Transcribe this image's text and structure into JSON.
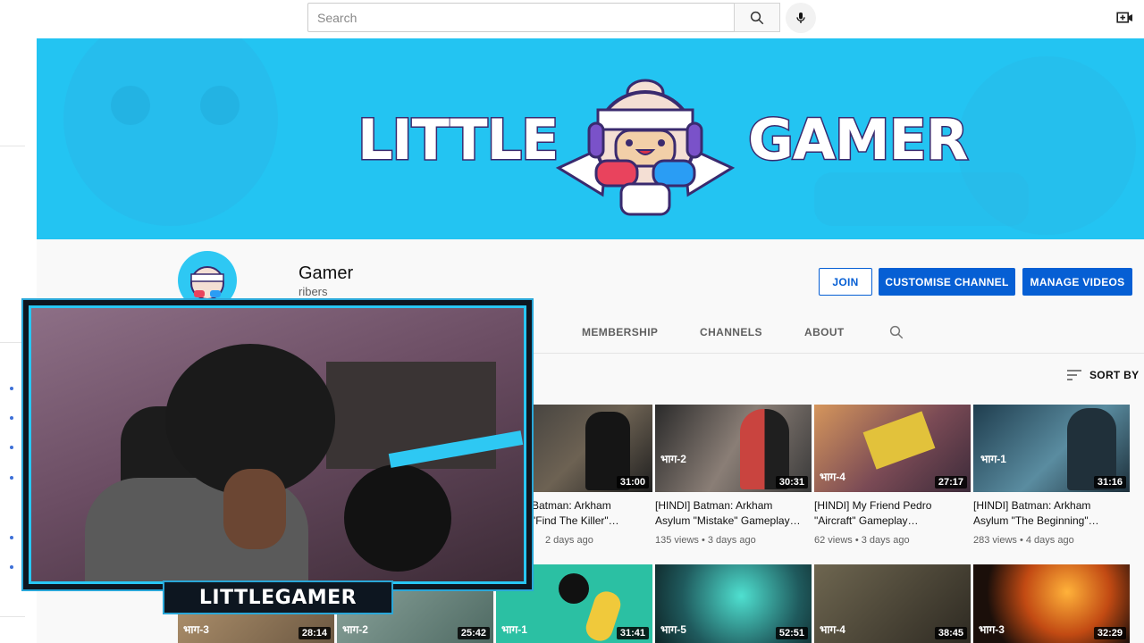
{
  "search": {
    "placeholder": "Search"
  },
  "icons": {
    "search_button": "search-icon",
    "mic": "mic-icon",
    "create": "video-camera-plus-icon",
    "sort": "sort-lines-icon",
    "tab_search": "search-icon"
  },
  "banner": {
    "left_word": "LITTLE",
    "right_word": "GAMER",
    "accent_color": "#23c4f2"
  },
  "channel": {
    "name_visible": "Gamer",
    "subs_visible": "ribers"
  },
  "actions": {
    "join": "JOIN",
    "customise": "CUSTOMISE CHANNEL",
    "manage": "MANAGE VIDEOS"
  },
  "tabs": [
    "MEMBERSHIP",
    "CHANNELS",
    "ABOUT"
  ],
  "sort_label": "SORT BY",
  "videos_row1": [
    {
      "title_l1": "Batman: Arkham",
      "title_l2": "\"Find The Killer\"…",
      "meta": "2 days ago",
      "duration": "31:00",
      "badge": ""
    },
    {
      "title_l1": "[HINDI] Batman: Arkham",
      "title_l2": "Asylum \"Mistake\" Gameplay…",
      "meta": "135 views • 3 days ago",
      "duration": "30:31",
      "badge": "भाग-2"
    },
    {
      "title_l1": "[HINDI] My Friend Pedro",
      "title_l2": "\"Aircraft\" Gameplay…",
      "meta": "62 views • 3 days ago",
      "duration": "27:17",
      "badge": "भाग-4"
    },
    {
      "title_l1": "[HINDI] Batman: Arkham",
      "title_l2": "Asylum \"The Beginning\"…",
      "meta": "283 views • 4 days ago",
      "duration": "31:16",
      "badge": "भाग-1"
    }
  ],
  "videos_row2": [
    {
      "duration": "28:14",
      "badge": "भाग-3"
    },
    {
      "duration": "25:42",
      "badge": "भाग-2"
    },
    {
      "duration": "31:41",
      "badge": "भाग-1"
    },
    {
      "duration": "52:51",
      "badge": "भाग-5"
    },
    {
      "duration": "38:45",
      "badge": "भाग-4"
    },
    {
      "duration": "32:29",
      "badge": "भाग-3"
    }
  ],
  "webcam": {
    "tag": "LITTLEGAMER"
  }
}
